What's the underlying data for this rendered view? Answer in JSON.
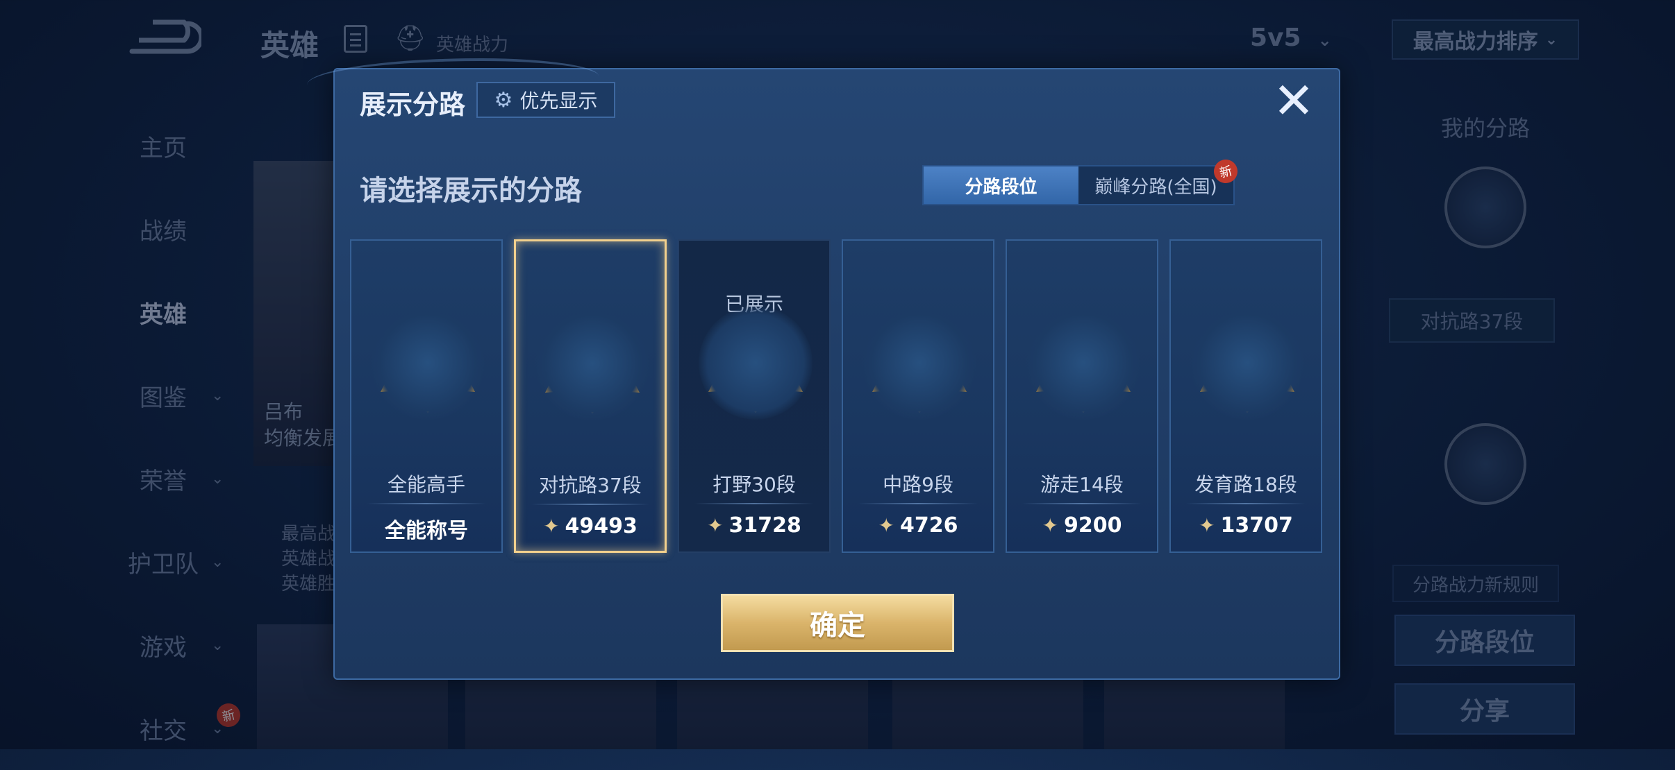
{
  "background": {
    "title": "英雄",
    "subtitle": "英雄战力",
    "mode_select": "5v5",
    "sort_select": "最高战力排序",
    "nav": [
      {
        "label": "主页",
        "has_chevron": false
      },
      {
        "label": "战绩",
        "has_chevron": false
      },
      {
        "label": "英雄",
        "has_chevron": false,
        "active": true
      },
      {
        "label": "图鉴",
        "has_chevron": true
      },
      {
        "label": "荣誉",
        "has_chevron": true
      },
      {
        "label": "护卫队",
        "has_chevron": true
      },
      {
        "label": "游戏",
        "has_chevron": true
      },
      {
        "label": "社交",
        "has_chevron": true,
        "badge": "新"
      }
    ],
    "hero_name_line1": "吕布",
    "hero_name_line2": "均衡发展",
    "hero_info": [
      "最高战",
      "英雄战",
      "英雄胜"
    ],
    "right_panel": {
      "title": "我的分路",
      "lane_rank": "对抗路37段",
      "rule_link": "分路战力新规则",
      "lane_rank_button": "分路段位",
      "share_button": "分享"
    }
  },
  "dialog": {
    "title": "展示分路",
    "priority_button": "优先显示",
    "close_icon": "close-icon",
    "subtitle": "请选择展示的分路",
    "tabs": [
      {
        "label": "分路段位",
        "active": true
      },
      {
        "label": "巅峰分路(全国)",
        "active": false,
        "badge": "新"
      }
    ],
    "shown_tag": "已展示",
    "cards": [
      {
        "name": "全能高手",
        "value": "全能称号",
        "has_power_icon": false,
        "color": "#c23cc6",
        "icon": "omni-emblem-icon"
      },
      {
        "name": "对抗路37段",
        "value": "49493",
        "has_power_icon": true,
        "color": "#3fb6e8",
        "icon": "clash-lane-emblem-icon",
        "selected": true
      },
      {
        "name": "打野30段",
        "value": "31728",
        "has_power_icon": true,
        "color": "#3a6fb8",
        "icon": "jungle-emblem-icon",
        "shown": true
      },
      {
        "name": "中路9段",
        "value": "4726",
        "has_power_icon": true,
        "color": "#c48a2a",
        "icon": "mid-lane-emblem-icon"
      },
      {
        "name": "游走14段",
        "value": "9200",
        "has_power_icon": true,
        "color": "#1fa58a",
        "icon": "roam-emblem-icon"
      },
      {
        "name": "发育路18段",
        "value": "13707",
        "has_power_icon": true,
        "color": "#2bbfa3",
        "icon": "farm-lane-emblem-icon"
      }
    ],
    "confirm_button": "确定"
  }
}
